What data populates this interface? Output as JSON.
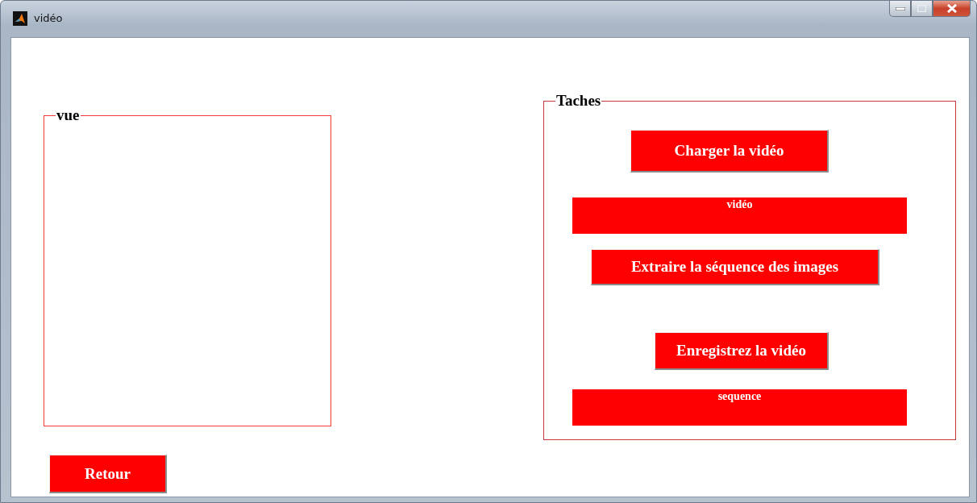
{
  "window": {
    "title": "vidéo"
  },
  "view_panel": {
    "title": "vue"
  },
  "tasks_panel": {
    "title": "Taches",
    "items": [
      {
        "kind": "button",
        "label": "Charger la vidéo"
      },
      {
        "kind": "text",
        "label": "vidéo"
      },
      {
        "kind": "button",
        "label": "Extraire la séquence des images"
      },
      {
        "kind": "button",
        "label": "Enregistrez la vidéo"
      },
      {
        "kind": "text",
        "label": "sequence"
      }
    ]
  },
  "back_button": {
    "label": "Retour"
  }
}
